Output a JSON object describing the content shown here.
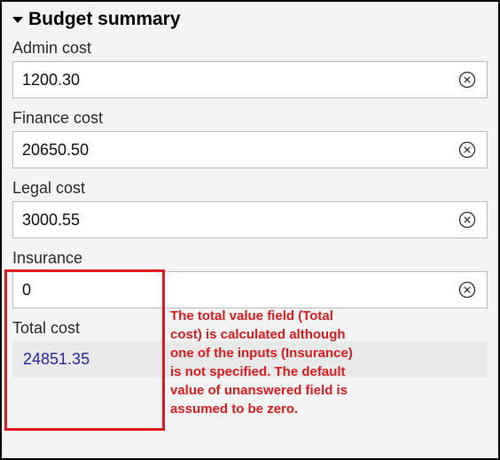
{
  "header": {
    "title": "Budget summary"
  },
  "fields": {
    "admin": {
      "label": "Admin cost",
      "value": "1200.30"
    },
    "finance": {
      "label": "Finance cost",
      "value": "20650.50"
    },
    "legal": {
      "label": "Legal cost",
      "value": "3000.55"
    },
    "insurance": {
      "label": "Insurance",
      "value": "0"
    }
  },
  "total": {
    "label": "Total cost",
    "value": "24851.35"
  },
  "annotation": {
    "text": "The total value field (Total cost) is calculated although one of the inputs (Insurance) is not specified. The default value of unanswered field is assumed to be zero."
  }
}
